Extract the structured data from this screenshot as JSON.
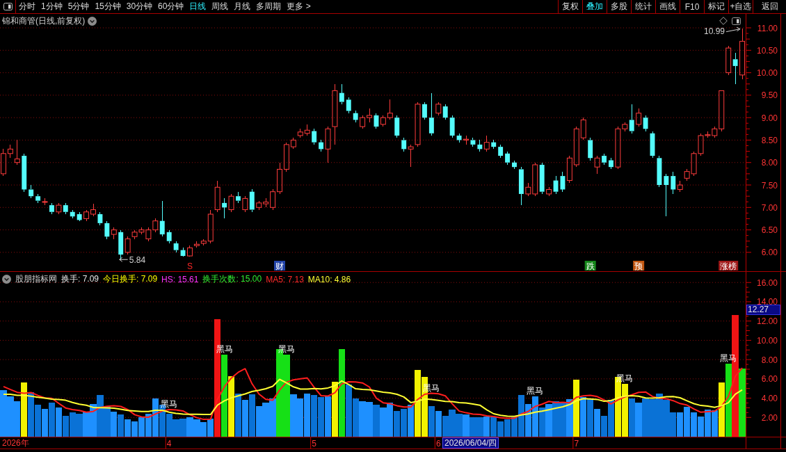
{
  "toolbar": {
    "periods": [
      {
        "label": "分时",
        "selected": false
      },
      {
        "label": "1分钟",
        "selected": false
      },
      {
        "label": "5分钟",
        "selected": false
      },
      {
        "label": "15分钟",
        "selected": false
      },
      {
        "label": "30分钟",
        "selected": false
      },
      {
        "label": "60分钟",
        "selected": false
      },
      {
        "label": "日线",
        "selected": true
      },
      {
        "label": "周线",
        "selected": false
      },
      {
        "label": "月线",
        "selected": false
      },
      {
        "label": "多周期",
        "selected": false
      }
    ],
    "more_menu": "更多 >",
    "tools": [
      {
        "label": "复权",
        "active": false
      },
      {
        "label": "叠加",
        "active": true
      },
      {
        "label": "多股",
        "active": false
      },
      {
        "label": "统计",
        "active": false
      },
      {
        "label": "画线",
        "active": false
      },
      {
        "label": "F10",
        "active": false
      },
      {
        "label": "标记",
        "active": false
      },
      {
        "label": "+自选",
        "active": false
      },
      {
        "label": "返回",
        "active": false
      }
    ]
  },
  "price_pane": {
    "title": "锦和商管(日线,前复权)",
    "chart_data": [
      {
        "type": "candlestick",
        "grid": true,
        "ylim": [
          5.58,
          11.31
        ],
        "yticks": [
          {
            "value": 6,
            "label": "6.00"
          },
          {
            "value": 6.5,
            "label": "6.50"
          },
          {
            "value": 7,
            "label": "7.00"
          },
          {
            "value": 7.5,
            "label": "7.50"
          },
          {
            "value": 8,
            "label": "8.00"
          },
          {
            "value": 8.5,
            "label": "8.50"
          },
          {
            "value": 9,
            "label": "9.00"
          },
          {
            "value": 9.5,
            "label": "9.50"
          },
          {
            "value": 10,
            "label": "10.00"
          },
          {
            "value": 10.5,
            "label": "10.50"
          },
          {
            "value": 11,
            "label": "11.00"
          }
        ],
        "annotations": [
          "10.99",
          "5.84"
        ],
        "ohlc": [
          [
            7.75,
            8.3,
            7.7,
            8.2
          ],
          [
            8.2,
            8.4,
            8.1,
            8.3
          ],
          [
            8.0,
            8.5,
            7.95,
            8.08
          ],
          [
            8.15,
            8.2,
            7.35,
            7.4
          ],
          [
            7.4,
            7.5,
            7.2,
            7.25
          ],
          [
            7.25,
            7.3,
            7.1,
            7.15
          ],
          [
            7.12,
            7.2,
            7.05,
            7.13
          ],
          [
            7.05,
            7.1,
            6.85,
            6.9
          ],
          [
            6.9,
            7.1,
            6.85,
            7.05
          ],
          [
            7.05,
            7.1,
            6.85,
            6.9
          ],
          [
            6.9,
            6.95,
            6.75,
            6.8
          ],
          [
            6.85,
            6.9,
            6.7,
            6.72
          ],
          [
            6.75,
            6.95,
            6.7,
            6.9
          ],
          [
            6.85,
            7.08,
            6.8,
            6.95
          ],
          [
            6.85,
            6.9,
            6.6,
            6.65
          ],
          [
            6.65,
            6.7,
            6.3,
            6.35
          ],
          [
            6.4,
            6.55,
            6.3,
            6.5
          ],
          [
            6.45,
            6.5,
            5.84,
            5.95
          ],
          [
            6.0,
            6.35,
            5.95,
            6.3
          ],
          [
            6.35,
            6.5,
            6.3,
            6.45
          ],
          [
            6.45,
            6.55,
            6.4,
            6.5
          ],
          [
            6.3,
            6.55,
            6.25,
            6.5
          ],
          [
            6.5,
            6.75,
            6.45,
            6.7
          ],
          [
            6.7,
            7.15,
            6.35,
            6.4
          ],
          [
            6.45,
            6.5,
            6.2,
            6.25
          ],
          [
            6.2,
            6.25,
            6.0,
            6.05
          ],
          [
            6.05,
            6.1,
            5.9,
            5.92
          ],
          [
            5.92,
            6.15,
            5.9,
            6.1
          ],
          [
            6.15,
            6.25,
            6.1,
            6.18
          ],
          [
            6.2,
            6.3,
            6.15,
            6.25
          ],
          [
            6.25,
            6.95,
            6.2,
            6.85
          ],
          [
            6.95,
            7.6,
            6.9,
            7.45
          ],
          [
            7.1,
            7.2,
            6.75,
            7.0
          ],
          [
            6.95,
            7.3,
            6.9,
            7.25
          ],
          [
            7.25,
            7.35,
            7.1,
            7.15
          ],
          [
            6.95,
            7.25,
            6.9,
            7.2
          ],
          [
            7.35,
            7.4,
            6.9,
            6.95
          ],
          [
            7.0,
            7.15,
            6.95,
            7.1
          ],
          [
            7.08,
            7.2,
            7.0,
            7.12
          ],
          [
            7.0,
            7.4,
            6.95,
            7.35
          ],
          [
            7.35,
            8.0,
            7.3,
            7.85
          ],
          [
            7.85,
            8.45,
            7.8,
            8.4
          ],
          [
            8.35,
            8.55,
            8.3,
            8.5
          ],
          [
            8.6,
            8.75,
            8.55,
            8.68
          ],
          [
            8.65,
            8.85,
            8.6,
            8.72
          ],
          [
            8.7,
            8.75,
            8.4,
            8.45
          ],
          [
            8.45,
            8.5,
            8.25,
            8.3
          ],
          [
            8.3,
            8.8,
            8.0,
            8.75
          ],
          [
            8.8,
            9.75,
            8.4,
            9.6
          ],
          [
            9.55,
            9.75,
            9.3,
            9.35
          ],
          [
            9.4,
            9.45,
            9.1,
            9.15
          ],
          [
            9.1,
            9.15,
            8.9,
            8.95
          ],
          [
            8.8,
            9.05,
            8.75,
            9.0
          ],
          [
            9.0,
            9.2,
            8.9,
            9.05
          ],
          [
            9.05,
            9.1,
            8.75,
            8.8
          ],
          [
            8.85,
            9.05,
            8.8,
            9.0
          ],
          [
            9.0,
            9.4,
            8.95,
            9.1
          ],
          [
            9.0,
            9.05,
            8.55,
            8.6
          ],
          [
            8.5,
            8.55,
            8.25,
            8.3
          ],
          [
            8.3,
            8.4,
            7.9,
            8.35
          ],
          [
            8.4,
            9.35,
            8.35,
            9.3
          ],
          [
            9.3,
            9.35,
            8.95,
            9.0
          ],
          [
            9.0,
            9.55,
            8.6,
            8.65
          ],
          [
            9.1,
            9.35,
            9.05,
            9.3
          ],
          [
            9.25,
            9.3,
            8.95,
            9.0
          ],
          [
            9.0,
            9.05,
            8.55,
            8.6
          ],
          [
            8.6,
            8.65,
            8.45,
            8.5
          ],
          [
            8.5,
            8.6,
            8.4,
            8.52
          ],
          [
            8.5,
            8.55,
            8.35,
            8.4
          ],
          [
            8.4,
            8.5,
            8.25,
            8.3
          ],
          [
            8.3,
            8.6,
            8.25,
            8.45
          ],
          [
            8.45,
            8.5,
            8.3,
            8.35
          ],
          [
            8.35,
            8.4,
            8.1,
            8.15
          ],
          [
            8.2,
            8.25,
            7.95,
            8.0
          ],
          [
            8.0,
            8.05,
            7.85,
            7.9
          ],
          [
            7.85,
            7.9,
            7.05,
            7.3
          ],
          [
            7.3,
            7.55,
            7.25,
            7.45
          ],
          [
            7.3,
            8.0,
            7.25,
            7.95
          ],
          [
            7.95,
            8.0,
            7.3,
            7.35
          ],
          [
            7.3,
            7.45,
            7.25,
            7.4
          ],
          [
            7.6,
            7.7,
            7.3,
            7.35
          ],
          [
            7.7,
            7.8,
            7.35,
            7.4
          ],
          [
            7.6,
            8.15,
            7.55,
            8.1
          ],
          [
            7.95,
            8.8,
            7.9,
            8.75
          ],
          [
            8.55,
            9.0,
            8.5,
            8.95
          ],
          [
            8.5,
            8.55,
            8.05,
            8.1
          ],
          [
            7.9,
            8.15,
            7.75,
            8.1
          ],
          [
            8.15,
            8.2,
            7.95,
            8.0
          ],
          [
            8.05,
            8.1,
            7.85,
            7.9
          ],
          [
            7.9,
            8.8,
            7.85,
            8.75
          ],
          [
            8.75,
            8.9,
            8.7,
            8.85
          ],
          [
            8.95,
            9.3,
            8.65,
            8.7
          ],
          [
            8.85,
            9.2,
            8.8,
            9.1
          ],
          [
            9.0,
            9.05,
            8.7,
            8.75
          ],
          [
            8.65,
            8.7,
            8.1,
            8.15
          ],
          [
            8.1,
            8.15,
            7.45,
            7.5
          ],
          [
            7.7,
            7.75,
            6.8,
            7.5
          ],
          [
            7.7,
            7.8,
            7.3,
            7.4
          ],
          [
            7.4,
            7.6,
            7.35,
            7.5
          ],
          [
            7.65,
            7.85,
            7.6,
            7.8
          ],
          [
            7.75,
            8.25,
            7.7,
            8.2
          ],
          [
            8.2,
            8.65,
            8.15,
            8.6
          ],
          [
            8.6,
            8.7,
            8.55,
            8.62
          ],
          [
            8.6,
            8.8,
            8.55,
            8.75
          ],
          [
            8.75,
            9.6,
            8.7,
            9.6
          ],
          [
            10.0,
            10.6,
            9.95,
            10.55
          ],
          [
            10.3,
            10.45,
            9.75,
            10.15
          ],
          [
            9.95,
            10.99,
            9.85,
            10.7
          ]
        ]
      }
    ],
    "event_marks": [
      {
        "text": "S",
        "kind": "text",
        "color": "#ff2828"
      },
      {
        "text": "财",
        "kind": "tag",
        "color": "#2344a8"
      },
      {
        "text": "跌",
        "kind": "tag",
        "color": "#15861a"
      },
      {
        "text": "预",
        "kind": "tag",
        "color": "#c0550f"
      },
      {
        "text": "涨榜",
        "kind": "tag",
        "color": "#a01818"
      }
    ]
  },
  "indicator_pane": {
    "name": "股朋指标网",
    "legend": [
      {
        "text": "换手: 7.09",
        "color": "#e6e6e6"
      },
      {
        "text": "今日换手: 7.09",
        "color": "#ffff00"
      },
      {
        "text": "HS: 15.61",
        "color": "#ff33ff"
      },
      {
        "text": "换手次数: 15.00",
        "color": "#33ee33"
      },
      {
        "text": "MA5: 7.13",
        "color": "#ff2a2a"
      },
      {
        "text": "MA10: 4.86",
        "color": "#ffff33"
      }
    ],
    "cursor_value": "12.27",
    "chart_data": [
      {
        "type": "bar",
        "grid": true,
        "ylim": [
          0,
          17.1
        ],
        "yticks": [
          {
            "value": 2,
            "label": "2.00"
          },
          {
            "value": 4,
            "label": "4.00"
          },
          {
            "value": 6,
            "label": "6.00"
          },
          {
            "value": 8,
            "label": "8.00"
          },
          {
            "value": 10,
            "label": "10.00"
          },
          {
            "value": 12,
            "label": "12.00"
          },
          {
            "value": 14,
            "label": "14.00"
          },
          {
            "value": 16,
            "label": "16.00"
          }
        ],
        "categories": [
          null,
          null,
          null,
          null,
          null,
          null,
          null,
          null,
          null,
          null,
          null,
          null,
          null,
          null,
          null,
          null,
          null,
          null,
          null,
          null,
          null,
          null,
          null,
          null,
          "4",
          null,
          null,
          null,
          null,
          null,
          null,
          null,
          null,
          null,
          null,
          null,
          null,
          null,
          null,
          null,
          null,
          null,
          null,
          null,
          null,
          "5",
          null,
          null,
          null,
          null,
          null,
          null,
          null,
          null,
          null,
          null,
          null,
          null,
          null,
          null,
          null,
          null,
          null,
          "6",
          null,
          null,
          null,
          null,
          null,
          null,
          null,
          null,
          null,
          null,
          null,
          null,
          null,
          null,
          null,
          null,
          null,
          null,
          null,
          "7",
          null,
          null,
          null,
          null,
          null,
          null,
          null,
          null,
          null,
          null,
          null,
          null,
          null,
          null,
          null,
          null,
          null,
          null,
          null,
          null,
          null,
          null,
          null,
          null
        ],
        "series": [
          {
            "type": "bar",
            "values": [
              4.8,
              4.2,
              3.7,
              5.6,
              4.6,
              3.3,
              2.9,
              3.5,
              3.0,
              2.2,
              2.5,
              2.4,
              2.6,
              3.4,
              4.3,
              3.1,
              2.6,
              2.3,
              1.8,
              1.6,
              2.0,
              2.4,
              4.0,
              3.3,
              2.4,
              1.8,
              1.9,
              2.0,
              1.8,
              1.5,
              1.9,
              12.2,
              8.5,
              6.3,
              4.5,
              3.8,
              4.4,
              3.2,
              3.5,
              4.0,
              9.1,
              8.5,
              4.4,
              4.0,
              4.5,
              4.3,
              4.1,
              4.2,
              5.7,
              9.1,
              5.4,
              4.0,
              3.7,
              3.6,
              3.3,
              3.0,
              3.5,
              2.7,
              2.9,
              3.3,
              6.9,
              6.2,
              3.2,
              2.7,
              2.2,
              2.8,
              2.4,
              2.3,
              2.0,
              2.0,
              2.1,
              2.1,
              1.6,
              1.8,
              2.0,
              4.3,
              3.4,
              4.2,
              3.0,
              3.4,
              3.7,
              3.6,
              3.9,
              5.9,
              4.1,
              4.0,
              2.9,
              2.2,
              3.8,
              6.2,
              5.5,
              4.0,
              3.5,
              4.0,
              3.9,
              4.5,
              3.8,
              2.5,
              2.5,
              3.1,
              2.5,
              2.1,
              2.8,
              2.75,
              5.6,
              7.6,
              12.6,
              7.09
            ],
            "colors": [
              "#1e90ff",
              "#1e90ff",
              "#1e90ff",
              "#f2f200",
              "#0a72d6",
              "#0a72d6",
              "#1e90ff",
              "#0a72d6",
              "#1e90ff",
              "#0a72d6",
              "#0a72d6",
              "#0a72d6",
              "#1e90ff",
              "#1e90ff",
              "#0a72d6",
              "#0a72d6",
              "#1e90ff",
              "#0a72d6",
              "#1e90ff",
              "#1e90ff",
              "#1e90ff",
              "#1e90ff",
              "#1e90ff",
              "#0a72d6",
              "#0a72d6",
              "#0a72d6",
              "#0a72d6",
              "#1e90ff",
              "#1e90ff",
              "#1e90ff",
              "#1e90ff",
              "#f01414",
              "#16e016",
              "#f2f200",
              "#0a72d6",
              "#1e90ff",
              "#0a72d6",
              "#1e90ff",
              "#1e90ff",
              "#1e90ff",
              "#16e016",
              "#16e016",
              "#1e90ff",
              "#1e90ff",
              "#1e90ff",
              "#0a72d6",
              "#0a72d6",
              "#1e90ff",
              "#f2f200",
              "#16e016",
              "#0a72d6",
              "#0a72d6",
              "#1e90ff",
              "#1e90ff",
              "#0a72d6",
              "#1e90ff",
              "#1e90ff",
              "#0a72d6",
              "#0a72d6",
              "#1e90ff",
              "#f2f200",
              "#f2f200",
              "#0a72d6",
              "#1e90ff",
              "#0a72d6",
              "#0a72d6",
              "#0a72d6",
              "#1e90ff",
              "#0a72d6",
              "#0a72d6",
              "#1e90ff",
              "#0a72d6",
              "#0a72d6",
              "#0a72d6",
              "#0a72d6",
              "#0a72d6",
              "#1e90ff",
              "#1e90ff",
              "#0a72d6",
              "#1e90ff",
              "#0a72d6",
              "#0a72d6",
              "#1e90ff",
              "#f2f200",
              "#1e90ff",
              "#0a72d6",
              "#1e90ff",
              "#0a72d6",
              "#0a72d6",
              "#f2f200",
              "#f2f200",
              "#0a72d6",
              "#1e90ff",
              "#0a72d6",
              "#0a72d6",
              "#0a72d6",
              "#0a72d6",
              "#0a72d6",
              "#1e90ff",
              "#1e90ff",
              "#1e90ff",
              "#1e90ff",
              "#1e90ff",
              "#1e90ff",
              "#f2f200",
              "#16e016",
              "#f01414",
              "#16e016"
            ]
          },
          {
            "type": "line",
            "color": "#ff1e1e",
            "values": [
              5.2,
              4.9,
              4.6,
              4.5,
              4.58,
              4.28,
              4.02,
              3.98,
              3.46,
              2.98,
              2.82,
              2.72,
              2.54,
              2.62,
              3.04,
              3.16,
              3.2,
              3.14,
              2.82,
              2.28,
              2.06,
              2.02,
              2.36,
              2.66,
              2.82,
              2.78,
              2.68,
              2.28,
              1.98,
              1.8,
              1.82,
              3.88,
              5.18,
              6.08,
              6.68,
              7.06,
              5.5,
              4.44,
              3.88,
              3.78,
              4.84,
              5.66,
              5.9,
              6.0,
              6.1,
              5.14,
              4.26,
              4.22,
              4.56,
              5.48,
              5.7,
              5.68,
              5.58,
              5.16,
              4.0,
              3.52,
              3.42,
              3.22,
              3.08,
              3.08,
              3.86,
              4.4,
              4.5,
              4.46,
              4.24,
              3.42,
              2.66,
              2.48,
              2.34,
              2.3,
              2.16,
              2.1,
              1.96,
              1.92,
              1.92,
              2.36,
              2.62,
              3.14,
              3.38,
              3.66,
              3.54,
              3.58,
              3.52,
              4.1,
              4.24,
              4.3,
              4.16,
              3.82,
              3.4,
              3.82,
              4.12,
              4.34,
              4.6,
              4.64,
              4.18,
              3.98,
              3.94,
              3.74,
              3.44,
              3.28,
              2.88,
              2.54,
              2.6,
              2.65,
              3.15,
              4.17,
              6.27,
              7.13
            ]
          },
          {
            "type": "line",
            "color": "#ffff33",
            "values": [
              4.4,
              4.4,
              4.3,
              4.3,
              4.2,
              4.1,
              4.0,
              3.9,
              3.85,
              3.78,
              3.55,
              3.37,
              3.26,
              3.04,
              3.01,
              2.99,
              2.96,
              2.84,
              2.72,
              2.66,
              2.61,
              2.61,
              2.75,
              2.74,
              2.55,
              2.42,
              2.35,
              2.32,
              2.32,
              2.31,
              2.3,
              3.28,
              3.73,
              4.03,
              4.24,
              4.44,
              4.69,
              4.81,
              4.98,
              5.23,
              5.95,
              5.58,
              5.17,
              4.94,
              4.94,
              4.99,
              4.96,
              5.06,
              5.28,
              5.79,
              5.42,
              4.97,
              4.9,
              4.86,
              4.74,
              4.61,
              4.55,
              4.4,
              4.12,
              3.54,
              3.69,
              3.91,
              3.86,
              3.77,
              3.66,
              3.64,
              3.53,
              3.49,
              3.4,
              3.27,
              2.79,
              2.38,
              2.22,
              2.13,
              2.11,
              2.26,
              2.36,
              2.55,
              2.65,
              2.79,
              2.95,
              3.1,
              3.33,
              3.74,
              3.95,
              3.92,
              3.87,
              3.67,
              3.75,
              4.03,
              4.21,
              4.25,
              4.21,
              4.02,
              4.0,
              4.05,
              4.14,
              4.17,
              4.04,
              3.73,
              3.43,
              3.24,
              3.17,
              3.05,
              3.22,
              3.53,
              4.41,
              4.86
            ]
          }
        ]
      }
    ],
    "signal_labels": [
      "黑马",
      "黑马",
      "黑马",
      "黑马",
      "黑马",
      "黑马",
      "黑马"
    ]
  },
  "date_axis": {
    "year_label": "2026年",
    "cursor_date": "2026/06/04/四"
  }
}
